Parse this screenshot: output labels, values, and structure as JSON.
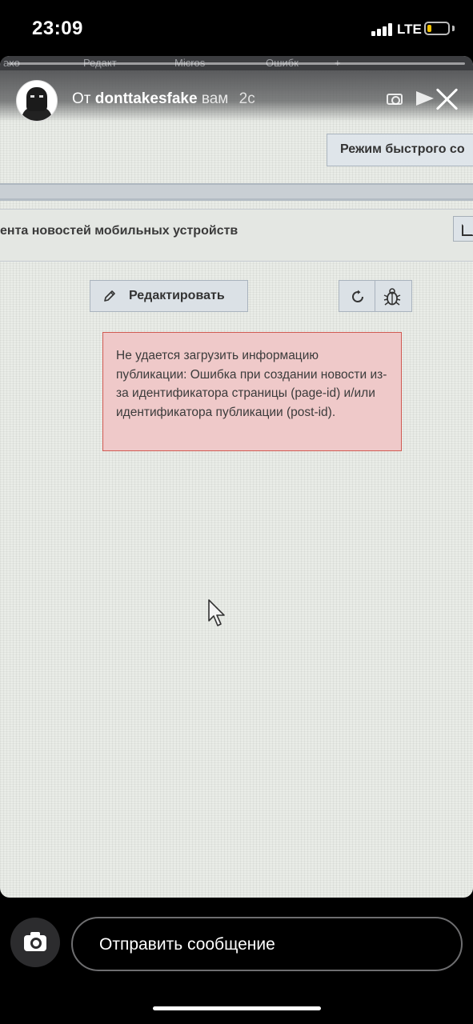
{
  "status_bar": {
    "time": "23:09",
    "network": "LTE",
    "battery_level": 0.2
  },
  "story_header": {
    "from_prefix": "От",
    "username": "donttakesfake",
    "recipient": "вам",
    "time_ago": "2с"
  },
  "photo": {
    "browser_tabs": [
      "ахо",
      "Редакт",
      "Micros",
      "Ошибк",
      "+"
    ],
    "quick_mode_button": "Режим быстрого со",
    "section_title": "ента новостей мобильных устройств",
    "edit_button": "Редактировать",
    "error_message": "Не удается загрузить информацию публикации: Ошибка при создании новости из-за идентификатора страницы (page-id) и/или идентификатора публикации (post-id)."
  },
  "composer": {
    "message_placeholder": "Отправить сообщение"
  },
  "icons": {
    "camera": "camera-icon",
    "send": "paper-plane-icon",
    "close": "close-icon",
    "edit": "pencil-icon",
    "refresh": "refresh-icon",
    "bug": "bug-icon",
    "cursor": "mouse-cursor-icon",
    "external": "external-link-icon"
  },
  "colors": {
    "error_background": "#efc9c9",
    "error_border": "#d05a52",
    "battery_fill": "#f2c200"
  }
}
